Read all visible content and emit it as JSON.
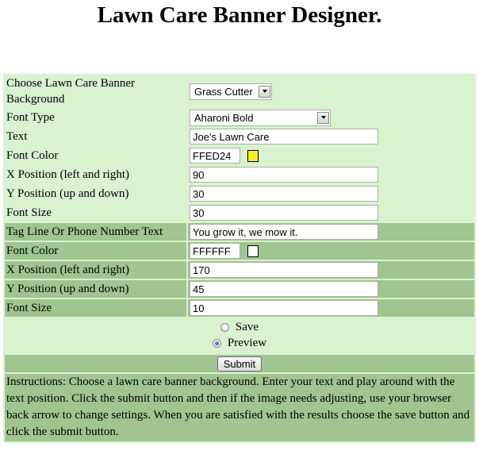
{
  "page": {
    "title": "Lawn Care Banner Designer."
  },
  "form": {
    "background": {
      "label": "Choose Lawn Care Banner Background",
      "selected": "Grass Cutter"
    },
    "font_type": {
      "label": "Font Type",
      "selected": "Aharoni Bold"
    },
    "text": {
      "label": "Text",
      "value": "Joe's Lawn Care"
    },
    "font_color": {
      "label": "Font Color",
      "value": "FFED24",
      "swatch": "#FFED24"
    },
    "x_position": {
      "label": "X Position (left and right)",
      "value": "90"
    },
    "y_position": {
      "label": "Y Position (up and down)",
      "value": "30"
    },
    "font_size": {
      "label": "Font Size",
      "value": "30"
    },
    "tagline": {
      "label": "Tag Line Or Phone Number Text",
      "value": "You grow it, we mow it."
    },
    "tag_font_color": {
      "label": "Font Color",
      "value": "FFFFFF",
      "swatch": "#FFFFFF"
    },
    "tag_x_position": {
      "label": "X Position (left and right)",
      "value": "170"
    },
    "tag_y_position": {
      "label": "Y Position (up and down)",
      "value": "45"
    },
    "tag_font_size": {
      "label": "Font Size",
      "value": "10"
    },
    "action": {
      "options": [
        {
          "label": "Save",
          "checked": false
        },
        {
          "label": "Preview",
          "checked": true
        }
      ]
    },
    "submit_label": "Submit",
    "instructions": "Instructions: Choose a lawn care banner background. Enter your text and play around with the text position. Click the submit button and then if the image needs adjusting, use your browser back arrow to change settings. When you are satisfied with the results choose the save button and click the submit button."
  },
  "colors": {
    "light_row": "#d9f2d0",
    "dark_row": "#a0c590"
  }
}
